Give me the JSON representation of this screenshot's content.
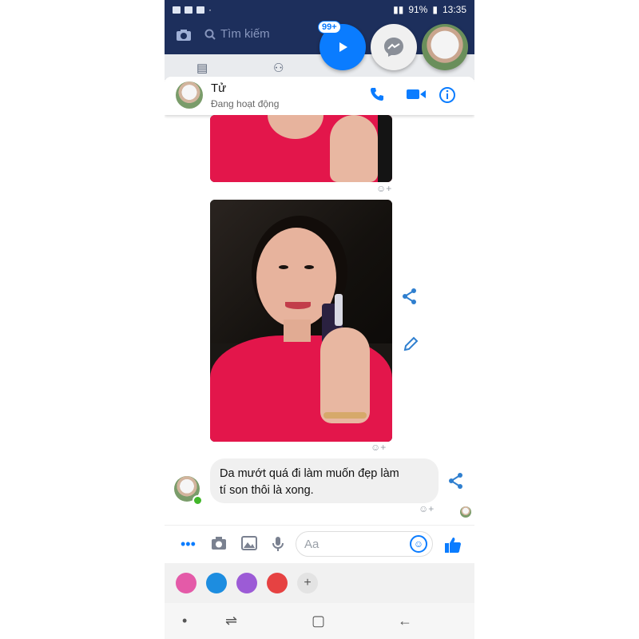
{
  "status_bar": {
    "battery": "91%",
    "time": "13:35"
  },
  "facebook": {
    "search_placeholder": "Tìm kiếm"
  },
  "chat_heads": {
    "badge_count": "99+"
  },
  "conversation": {
    "contact_name": "Tử",
    "contact_status": "Đang hoạt động"
  },
  "messages": [
    {
      "type": "photo"
    },
    {
      "type": "photo"
    },
    {
      "type": "text",
      "text_line1": "Da mướt quá đi làm muốn đẹp làm",
      "text_line2": "tí son thôi là xong."
    }
  ],
  "composer": {
    "placeholder": "Aa"
  },
  "icons": [
    "camera-icon",
    "search-icon",
    "play-icon",
    "messenger-icon",
    "phone-icon",
    "video-call-icon",
    "info-icon",
    "share-icon",
    "edit-icon",
    "more-icon",
    "image-icon",
    "mic-icon",
    "emoji-icon",
    "like-icon",
    "plus-icon"
  ],
  "colors": {
    "accent": "#0a7cff",
    "header_bg": "#1d2f5c",
    "shirt": "#e3164b",
    "bubble_bg": "#f0f0f0"
  }
}
